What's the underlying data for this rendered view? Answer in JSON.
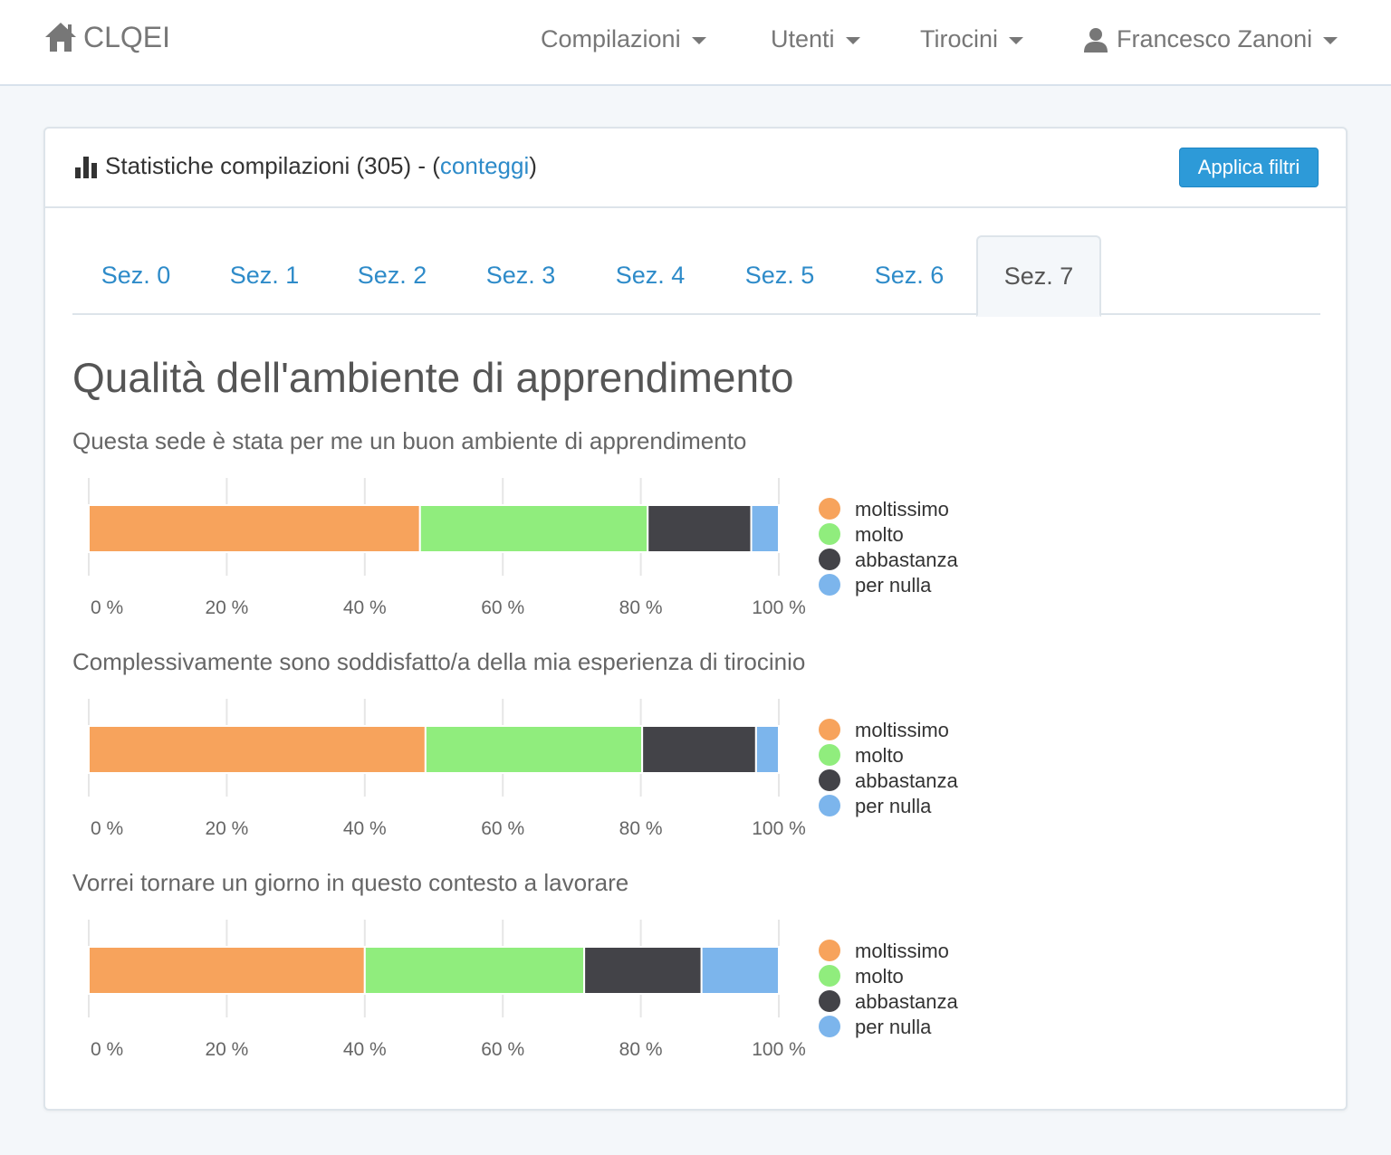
{
  "navbar": {
    "brand": "CLQEI",
    "items": [
      {
        "label": "Compilazioni"
      },
      {
        "label": "Utenti"
      },
      {
        "label": "Tirocini"
      }
    ],
    "user": "Francesco Zanoni"
  },
  "panel": {
    "title_prefix": "Statistiche compilazioni (305) - (",
    "title_link": "conteggi",
    "title_suffix": ")",
    "apply_button": "Applica filtri"
  },
  "tabs": [
    "Sez. 0",
    "Sez. 1",
    "Sez. 2",
    "Sez. 3",
    "Sez. 4",
    "Sez. 5",
    "Sez. 6",
    "Sez. 7"
  ],
  "active_tab": "Sez. 7",
  "section": {
    "title": "Qualità dell'ambiente di apprendimento"
  },
  "chart_data": [
    {
      "type": "bar",
      "orientation": "horizontal-stacked-percent",
      "title": "Questa sede è stata per me un buon ambiente di apprendimento",
      "series": [
        {
          "name": "moltissimo",
          "values": [
            48
          ]
        },
        {
          "name": "molto",
          "values": [
            33
          ]
        },
        {
          "name": "abbastanza",
          "values": [
            15
          ]
        },
        {
          "name": "per nulla",
          "values": [
            4
          ]
        }
      ],
      "xticks": [
        "0 %",
        "20 %",
        "40 %",
        "60 %",
        "80 %",
        "100 %"
      ],
      "xlim": [
        0,
        100
      ],
      "grid": true,
      "legend": "right",
      "colors": [
        "#f7a35c",
        "#90ed7d",
        "#434348",
        "#7cb5ec"
      ]
    },
    {
      "type": "bar",
      "orientation": "horizontal-stacked-percent",
      "title": "Complessivamente sono soddisfatto/a della mia esperienza di tirocinio",
      "series": [
        {
          "name": "moltissimo",
          "values": [
            48.8
          ]
        },
        {
          "name": "molto",
          "values": [
            31.4
          ]
        },
        {
          "name": "abbastanza",
          "values": [
            16.5
          ]
        },
        {
          "name": "per nulla",
          "values": [
            3.3
          ]
        }
      ],
      "xticks": [
        "0 %",
        "20 %",
        "40 %",
        "60 %",
        "80 %",
        "100 %"
      ],
      "xlim": [
        0,
        100
      ],
      "grid": true,
      "legend": "right",
      "colors": [
        "#f7a35c",
        "#90ed7d",
        "#434348",
        "#7cb5ec"
      ]
    },
    {
      "type": "bar",
      "orientation": "horizontal-stacked-percent",
      "title": "Vorrei tornare un giorno in questo contesto a lavorare",
      "series": [
        {
          "name": "moltissimo",
          "values": [
            40
          ]
        },
        {
          "name": "molto",
          "values": [
            31.8
          ]
        },
        {
          "name": "abbastanza",
          "values": [
            17
          ]
        },
        {
          "name": "per nulla",
          "values": [
            11.2
          ]
        }
      ],
      "xticks": [
        "0 %",
        "20 %",
        "40 %",
        "60 %",
        "80 %",
        "100 %"
      ],
      "xlim": [
        0,
        100
      ],
      "grid": true,
      "legend": "right",
      "colors": [
        "#f7a35c",
        "#90ed7d",
        "#434348",
        "#7cb5ec"
      ]
    }
  ]
}
